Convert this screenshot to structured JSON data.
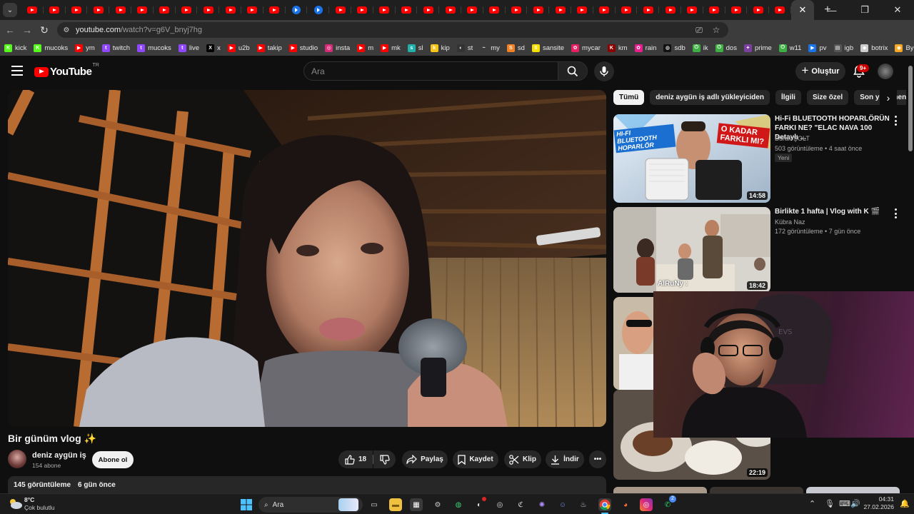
{
  "browser": {
    "url_domain": "youtube.com",
    "url_path": "/watch?v=g6V_bnyj7hg",
    "active_tab_close": "✕",
    "new_tab": "+",
    "bookmarks": [
      {
        "label": "kick",
        "icon": "kick-icon",
        "color": "#53fc18",
        "glyph": "K"
      },
      {
        "label": "mucoks",
        "icon": "kick-icon",
        "color": "#53fc18",
        "glyph": "K"
      },
      {
        "label": "ym",
        "icon": "youtube-icon",
        "color": "#ff0000",
        "glyph": "▶"
      },
      {
        "label": "twitch",
        "icon": "twitch-icon",
        "color": "#9146ff",
        "glyph": "t"
      },
      {
        "label": "mucoks",
        "icon": "twitch-icon",
        "color": "#9146ff",
        "glyph": "t"
      },
      {
        "label": "live",
        "icon": "twitch-icon",
        "color": "#9146ff",
        "glyph": "t"
      },
      {
        "label": "x",
        "icon": "x-icon",
        "color": "#000000",
        "glyph": "X"
      },
      {
        "label": "u2b",
        "icon": "youtube-icon",
        "color": "#ff0000",
        "glyph": "▶"
      },
      {
        "label": "takip",
        "icon": "youtube-icon",
        "color": "#ff0000",
        "glyph": "▶"
      },
      {
        "label": "studio",
        "icon": "youtube-icon",
        "color": "#ff0000",
        "glyph": "▶"
      },
      {
        "label": "insta",
        "icon": "instagram-icon",
        "color": "#d62976",
        "glyph": "◎"
      },
      {
        "label": "m",
        "icon": "youtube-icon",
        "color": "#ff0000",
        "glyph": "▶"
      },
      {
        "label": "mk",
        "icon": "youtube-icon",
        "color": "#ff0000",
        "glyph": "▶"
      },
      {
        "label": "sl",
        "icon": "sl-icon",
        "color": "#20b2aa",
        "glyph": "s"
      },
      {
        "label": "kip",
        "icon": "kip-icon",
        "color": "#f5c518",
        "glyph": "k"
      },
      {
        "label": "st",
        "icon": "github-icon",
        "color": "#333333",
        "glyph": "◐"
      },
      {
        "label": "my",
        "icon": "my-icon",
        "color": "#3c3c3c",
        "glyph": "~"
      },
      {
        "label": "sd",
        "icon": "sd-icon",
        "color": "#f48024",
        "glyph": "S"
      },
      {
        "label": "sansite",
        "icon": "sansite-icon",
        "color": "#f5e000",
        "glyph": "S"
      },
      {
        "label": "mycar",
        "icon": "mycar-icon",
        "color": "#e91e63",
        "glyph": "✿"
      },
      {
        "label": "km",
        "icon": "km-icon",
        "color": "#8b0000",
        "glyph": "K"
      },
      {
        "label": "rain",
        "icon": "rain-icon",
        "color": "#e91e8c",
        "glyph": "✿"
      },
      {
        "label": "sdb",
        "icon": "sdb-icon",
        "color": "#111111",
        "glyph": "◍"
      },
      {
        "label": "ik",
        "icon": "power-icon",
        "color": "#3cb043",
        "glyph": "⏻"
      },
      {
        "label": "dos",
        "icon": "power-icon",
        "color": "#3cb043",
        "glyph": "⏻"
      },
      {
        "label": "prime",
        "icon": "prime-icon",
        "color": "#7b3fa0",
        "glyph": "✦"
      },
      {
        "label": "w11",
        "icon": "power-icon",
        "color": "#3cb043",
        "glyph": "⏻"
      },
      {
        "label": "pv",
        "icon": "pv-icon",
        "color": "#1a73e8",
        "glyph": "▶"
      },
      {
        "label": "igb",
        "icon": "igb-icon",
        "color": "#555555",
        "glyph": "▤"
      },
      {
        "label": "botrix",
        "icon": "botrix-icon",
        "color": "#cccccc",
        "glyph": "◆"
      },
      {
        "label": "ByNo",
        "icon": "byno-icon",
        "color": "#f5a623",
        "glyph": "◉"
      }
    ]
  },
  "youtube": {
    "logo_text": "YouTube",
    "logo_region": "TR",
    "search_placeholder": "Ara",
    "create_label": "Oluştur",
    "notif_badge": "9+",
    "video": {
      "title": "Bir günüm vlog ✨",
      "channel": "deniz aygün iş",
      "subscribers": "154 abone",
      "subscribe_label": "Abone ol",
      "likes": "18",
      "share_label": "Paylaş",
      "save_label": "Kaydet",
      "clip_label": "Klip",
      "download_label": "İndir",
      "views": "145 görüntüleme",
      "age": "6 gün önce"
    },
    "chips": [
      "Tümü",
      "deniz aygün iş adlı yükleyiciden",
      "İlgili",
      "Size özel",
      "Son yüklenenler"
    ],
    "recommendations": [
      {
        "title": "Hi-Fi BLUETOOTH HOPARLÖRÜN FARKI NE? \"ELAC NAVA 100 Detaylı ...",
        "channel": "Burak ŞOLT",
        "meta": "503 görüntüleme • 4 saat önce",
        "badge": "Yeni",
        "duration": "14:58",
        "thumb_text_left": "HI-FI BLUETOOTH HOPARLÖR",
        "thumb_text_right": "O KADAR FARKLI MI?"
      },
      {
        "title": "Birlikte 1 hafta | Vlog with K 🎬",
        "channel": "Kübra Naz",
        "meta": "172 görüntüleme • 7 gün önce",
        "duration": "18:42",
        "overlay_text": "AlRuNy :"
      },
      {
        "duration": "22:19"
      }
    ]
  },
  "taskbar": {
    "weather_temp": "8°C",
    "weather_desc": "Çok bulutlu",
    "search_placeholder": "Ara",
    "time": "04:31",
    "date": "27.02.2026",
    "discord_badge": "2"
  }
}
